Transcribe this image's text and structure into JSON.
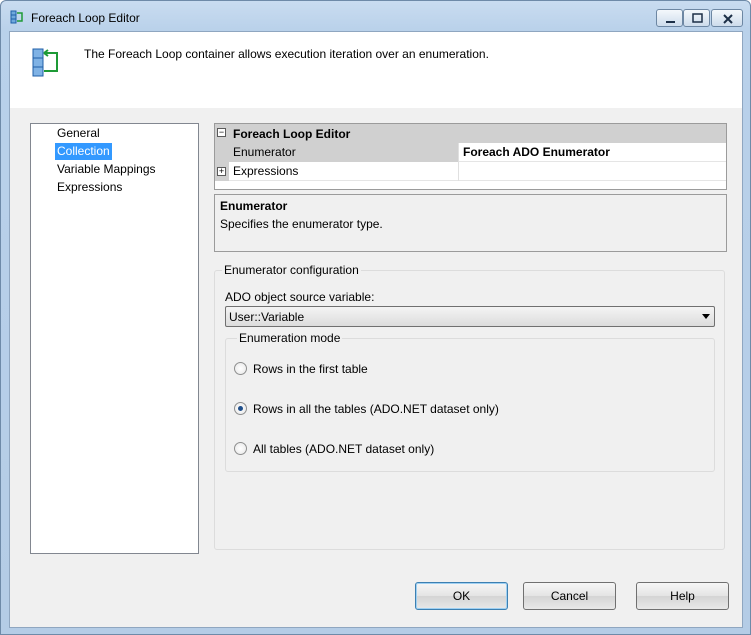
{
  "window": {
    "title": "Foreach Loop Editor",
    "accent": "#3399ff"
  },
  "header": {
    "description": "The Foreach Loop container allows execution iteration over an enumeration."
  },
  "nav": {
    "items": [
      {
        "label": "General",
        "selected": false
      },
      {
        "label": "Collection",
        "selected": true
      },
      {
        "label": "Variable Mappings",
        "selected": false
      },
      {
        "label": "Expressions",
        "selected": false
      }
    ]
  },
  "property_grid": {
    "category": "Foreach Loop Editor",
    "rows": [
      {
        "name": "Enumerator",
        "value": "Foreach ADO Enumerator"
      },
      {
        "name": "Expressions",
        "value": ""
      }
    ]
  },
  "help": {
    "title": "Enumerator",
    "text": "Specifies the enumerator type."
  },
  "config": {
    "legend": "Enumerator configuration",
    "source_label": "ADO object source variable:",
    "source_value": "User::Variable",
    "mode_legend": "Enumeration mode",
    "modes": [
      {
        "label": "Rows in the first table",
        "checked": false
      },
      {
        "label": "Rows in all the tables (ADO.NET dataset only)",
        "checked": true
      },
      {
        "label": "All tables (ADO.NET dataset only)",
        "checked": false
      }
    ]
  },
  "buttons": {
    "ok": "OK",
    "cancel": "Cancel",
    "help": "Help"
  }
}
